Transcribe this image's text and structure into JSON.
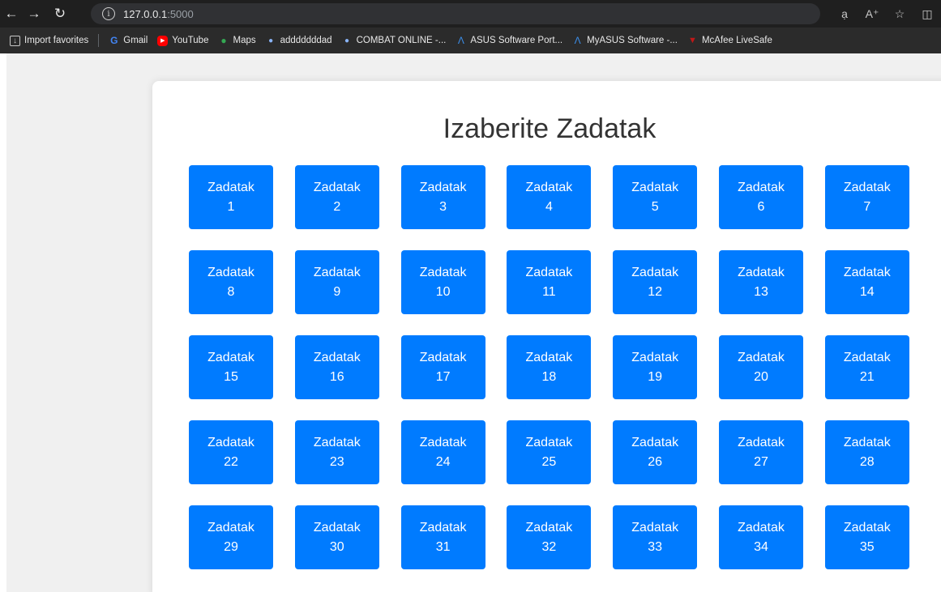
{
  "browser": {
    "url_host": "127.0.0.1",
    "url_port": ":5000",
    "bookmarks": [
      {
        "label": "Import favorites",
        "icon": "import-icon"
      },
      {
        "label": "Gmail",
        "icon": "google-icon"
      },
      {
        "label": "YouTube",
        "icon": "youtube-icon"
      },
      {
        "label": "Maps",
        "icon": "maps-icon"
      },
      {
        "label": "adddddddad",
        "icon": "globe-icon"
      },
      {
        "label": "COMBAT ONLINE -...",
        "icon": "globe-icon"
      },
      {
        "label": "ASUS Software Port...",
        "icon": "asus-icon"
      },
      {
        "label": "MyASUS Software -...",
        "icon": "asus-icon"
      },
      {
        "label": "McAfee LiveSafe",
        "icon": "mcafee-icon"
      }
    ]
  },
  "page": {
    "title": "Izaberite Zadatak",
    "task_word": "Zadatak",
    "tasks": [
      "1",
      "2",
      "3",
      "4",
      "5",
      "6",
      "7",
      "8",
      "9",
      "10",
      "11",
      "12",
      "13",
      "14",
      "15",
      "16",
      "17",
      "18",
      "19",
      "20",
      "21",
      "22",
      "23",
      "24",
      "25",
      "26",
      "27",
      "28",
      "29",
      "30",
      "31",
      "32",
      "33",
      "34",
      "35"
    ]
  },
  "colors": {
    "accent": "#007bff",
    "page_bg": "#f0f0f0"
  }
}
